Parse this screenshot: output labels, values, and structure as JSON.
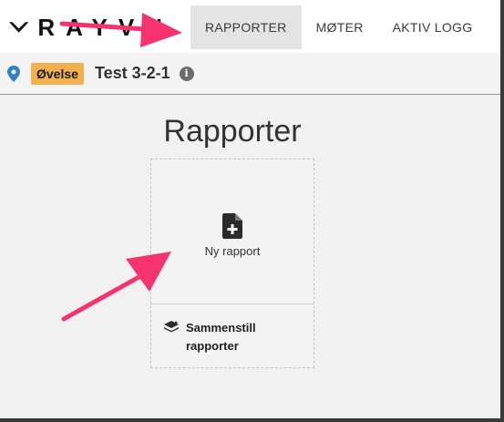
{
  "header": {
    "logo_text": "RAYVN",
    "nav": [
      {
        "label": "RAPPORTER",
        "active": true
      },
      {
        "label": "MØTER",
        "active": false
      },
      {
        "label": "AKTIV LOGG",
        "active": false
      }
    ]
  },
  "subheader": {
    "pin_icon": "map-pin-icon",
    "badge": "Øvelse",
    "badge_color": "#f2b04f",
    "title": "Test 3-2-1",
    "info_icon": "info-icon"
  },
  "main": {
    "title": "Rapporter",
    "new_report": {
      "icon": "file-plus-icon",
      "label": "Ny rapport"
    },
    "merge_reports": {
      "icon": "layers-icon",
      "label": "Sammenstill rapporter"
    }
  },
  "annotations": {
    "arrow_color": "#f5336e"
  }
}
